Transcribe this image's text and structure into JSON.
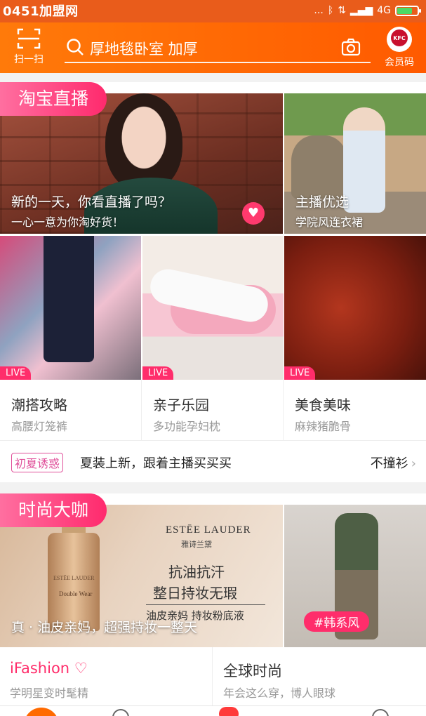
{
  "status_bar": {
    "watermark": "0451加盟网",
    "dots": "...",
    "network": "4G"
  },
  "header": {
    "scan_label": "扫一扫",
    "search_text": "厚地毯卧室 加厚",
    "member_label": "会员码",
    "kfc_logo_text": "KFC",
    "accent_color": "#ff6a00"
  },
  "live_section": {
    "tag": "淘宝直播",
    "main": {
      "title": "新的一天，你看直播了吗？",
      "subtitle": "一心一意为你淘好货！"
    },
    "side": {
      "title": "主播优选",
      "subtitle": "学院风连衣裙"
    },
    "live_badge": "LIVE",
    "categories": [
      {
        "title": "潮搭攻略",
        "subtitle": "高腰灯笼裤"
      },
      {
        "title": "亲子乐园",
        "subtitle": "多功能孕妇枕"
      },
      {
        "title": "美食美味",
        "subtitle": "麻辣猪脆骨"
      }
    ],
    "promo": {
      "tag": "初夏诱惑",
      "text": "夏装上新，跟着主播买买买",
      "right": "不撞衫",
      "chevron": "›"
    }
  },
  "fashion_section": {
    "tag": "时尚大咖",
    "main": {
      "caption": "真 · 油皮亲妈，超强持妆一整天",
      "brand_en": "ESTĒE LAUDER",
      "brand_cn": "雅诗兰黛",
      "ad_line1": "抗油抗汗",
      "ad_line2": "整日持妆无瑕",
      "ad_line3": "油皮亲妈 持妆粉底液",
      "bottle_brand": "ESTĒE LAUDER",
      "bottle_name": "Double Wear"
    },
    "side": {
      "hashtag": "#韩系风"
    },
    "categories": [
      {
        "title": "iFashion",
        "subtitle": "学明星变时髦精"
      },
      {
        "title": "全球时尚",
        "subtitle": "年会这么穿，博人眼球"
      }
    ]
  }
}
